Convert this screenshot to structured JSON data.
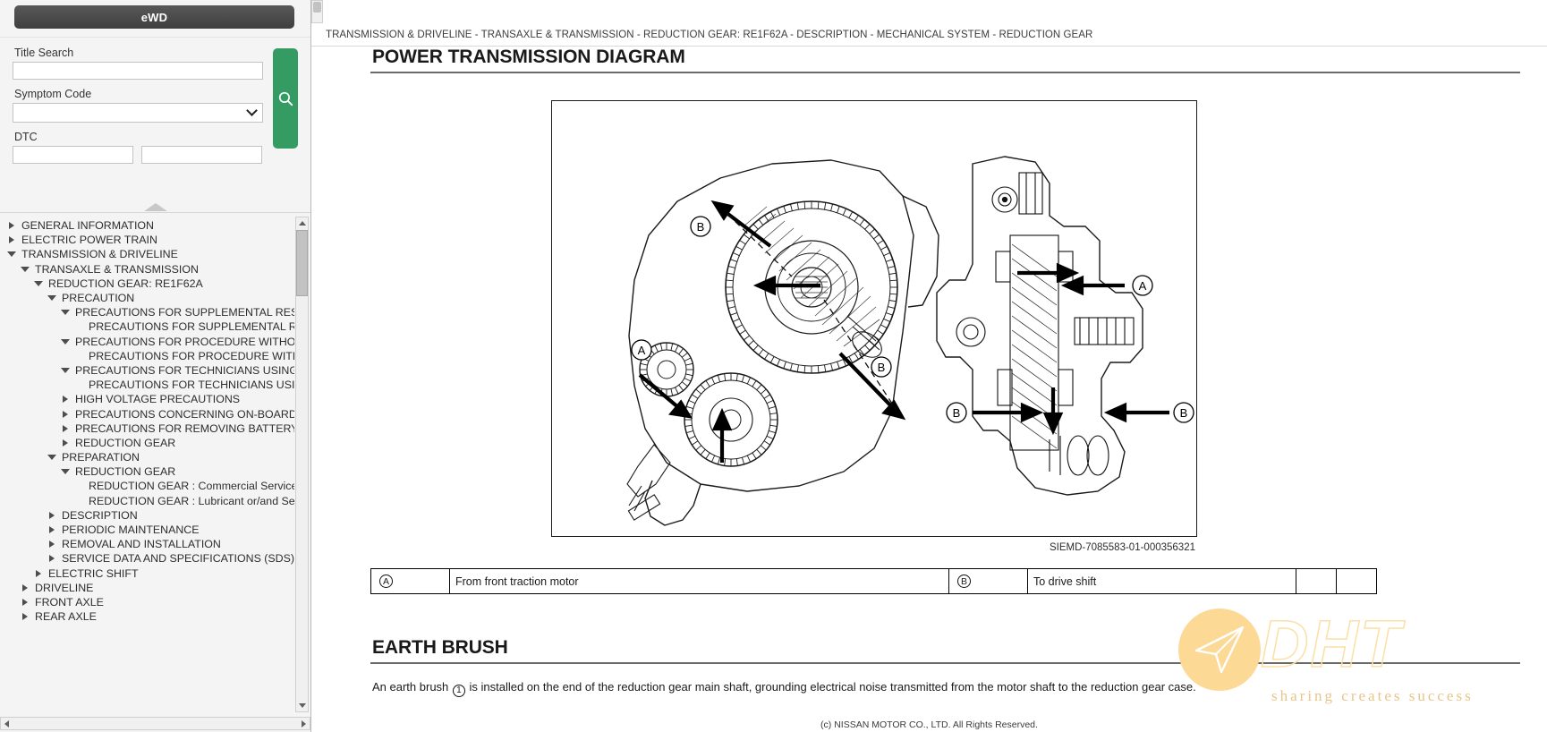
{
  "left_panel": {
    "tab_label": "eWD",
    "search": {
      "title_search_label": "Title Search",
      "title_search_value": "",
      "title_search_placeholder": "",
      "symptom_code_label": "Symptom Code",
      "symptom_code_value": "",
      "dtc_label": "DTC",
      "dtc_value_1": "",
      "dtc_value_2": "",
      "search_icon": "search-icon"
    },
    "tree": [
      {
        "label": "GENERAL INFORMATION",
        "indent": 0,
        "state": "collapsed"
      },
      {
        "label": "ELECTRIC POWER TRAIN",
        "indent": 0,
        "state": "collapsed"
      },
      {
        "label": "TRANSMISSION & DRIVELINE",
        "indent": 0,
        "state": "expanded"
      },
      {
        "label": "TRANSAXLE & TRANSMISSION",
        "indent": 1,
        "state": "expanded"
      },
      {
        "label": "REDUCTION GEAR: RE1F62A",
        "indent": 2,
        "state": "expanded"
      },
      {
        "label": "PRECAUTION",
        "indent": 3,
        "state": "expanded"
      },
      {
        "label": "PRECAUTIONS FOR SUPPLEMENTAL RESTRAINT SYSTEM",
        "indent": 4,
        "state": "expanded"
      },
      {
        "label": "PRECAUTIONS FOR SUPPLEMENTAL RESTRAINT SYSTEM",
        "indent": 5,
        "state": "leaf"
      },
      {
        "label": "PRECAUTIONS FOR PROCEDURE WITHOUT COWL TOP COVER",
        "indent": 4,
        "state": "expanded"
      },
      {
        "label": "PRECAUTIONS FOR PROCEDURE WITHOUT COWL TOP COVER",
        "indent": 5,
        "state": "leaf"
      },
      {
        "label": "PRECAUTIONS FOR TECHNICIANS USING MEDICAL ELECTRIC",
        "indent": 4,
        "state": "expanded"
      },
      {
        "label": "PRECAUTIONS FOR TECHNICIANS USING MEDICAL ELECTRIC",
        "indent": 5,
        "state": "leaf"
      },
      {
        "label": "HIGH VOLTAGE PRECAUTIONS",
        "indent": 4,
        "state": "collapsed"
      },
      {
        "label": "PRECAUTIONS CONCERNING ON-BOARD SERVICE",
        "indent": 4,
        "state": "collapsed"
      },
      {
        "label": "PRECAUTIONS FOR REMOVING BATTERY TERMINAL",
        "indent": 4,
        "state": "collapsed"
      },
      {
        "label": "REDUCTION GEAR",
        "indent": 4,
        "state": "collapsed"
      },
      {
        "label": "PREPARATION",
        "indent": 3,
        "state": "expanded"
      },
      {
        "label": "REDUCTION GEAR",
        "indent": 4,
        "state": "expanded"
      },
      {
        "label": "REDUCTION GEAR : Commercial Service Tools",
        "indent": 5,
        "state": "leaf"
      },
      {
        "label": "REDUCTION GEAR : Lubricant or/and Sealant",
        "indent": 5,
        "state": "leaf"
      },
      {
        "label": "DESCRIPTION",
        "indent": 3,
        "state": "collapsed"
      },
      {
        "label": "PERIODIC MAINTENANCE",
        "indent": 3,
        "state": "collapsed"
      },
      {
        "label": "REMOVAL AND INSTALLATION",
        "indent": 3,
        "state": "collapsed"
      },
      {
        "label": "SERVICE DATA AND SPECIFICATIONS (SDS)",
        "indent": 3,
        "state": "collapsed"
      },
      {
        "label": "ELECTRIC SHIFT",
        "indent": 2,
        "state": "collapsed"
      },
      {
        "label": "DRIVELINE",
        "indent": 1,
        "state": "collapsed"
      },
      {
        "label": "FRONT AXLE",
        "indent": 1,
        "state": "collapsed"
      },
      {
        "label": "REAR AXLE",
        "indent": 1,
        "state": "collapsed"
      }
    ]
  },
  "main": {
    "breadcrumb": "TRANSMISSION & DRIVELINE - TRANSAXLE & TRANSMISSION - REDUCTION GEAR: RE1F62A - DESCRIPTION - MECHANICAL SYSTEM - REDUCTION GEAR",
    "section_title": "POWER TRANSMISSION DIAGRAM",
    "figure_reference": "SIEMD-7085583-01-000356321",
    "legend": [
      {
        "key": "A",
        "value": "From front traction motor"
      },
      {
        "key": "B",
        "value": "To drive shift"
      }
    ],
    "earth_brush": {
      "title": "EARTH BRUSH",
      "body_prefix": "An earth brush ",
      "body_marker": "1",
      "body_suffix": " is installed on the end of the reduction gear main shaft, grounding electrical noise transmitted from the motor shaft to the reduction gear case."
    },
    "watermark": {
      "logo_text": "DHT",
      "tagline": "sharing  creates  success"
    },
    "footer": "(c) NISSAN MOTOR CO., LTD. All Rights Reserved."
  },
  "colors": {
    "search_button": "#349b63",
    "tab_dark": "#4a4a4a",
    "panel_bg": "#f4f4f4",
    "watermark_gold": "#fcd995"
  }
}
